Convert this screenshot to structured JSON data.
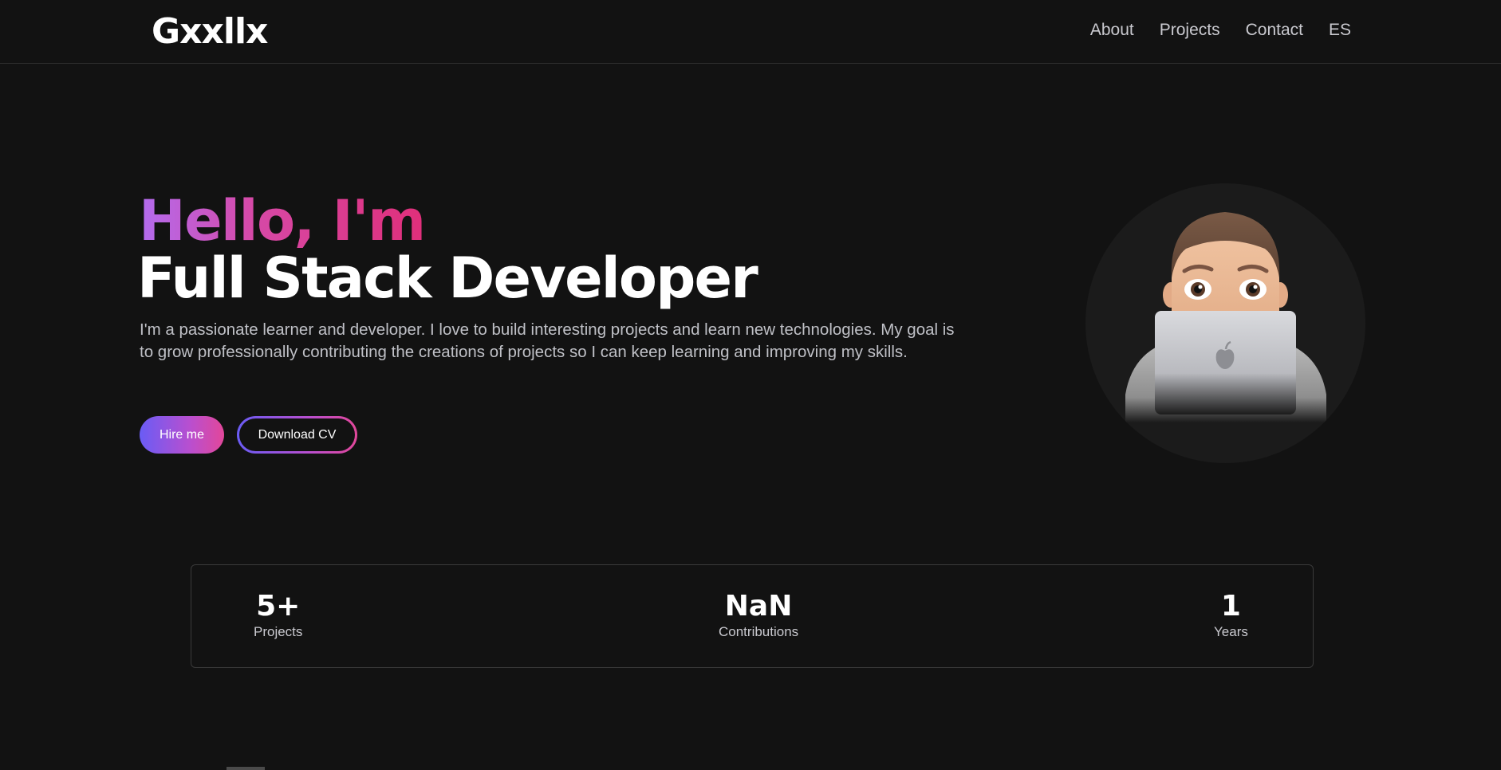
{
  "nav": {
    "logo": "Gxxllx",
    "links": [
      "About",
      "Projects",
      "Contact",
      "ES"
    ]
  },
  "hero": {
    "greeting": "Hello, I'm",
    "title": "Full Stack Developer",
    "description": "I'm a passionate learner and developer. I love to build interesting projects and learn new technologies. My goal is to grow professionally contributing the creations of projects so I can keep learning and improving my skills.",
    "hire_label": "Hire me",
    "cv_label": "Download CV"
  },
  "stats": [
    {
      "value": "5+",
      "label": "Projects"
    },
    {
      "value": "NaN",
      "label": "Contributions"
    },
    {
      "value": "1",
      "label": "Years"
    }
  ],
  "colors": {
    "background": "#121212",
    "accent_start": "#6a5cf5",
    "accent_end": "#e2479a",
    "greeting_start": "#b36cf0",
    "greeting_end": "#e02f7a"
  },
  "icons": {
    "avatar": "memoji-laptop-avatar"
  }
}
